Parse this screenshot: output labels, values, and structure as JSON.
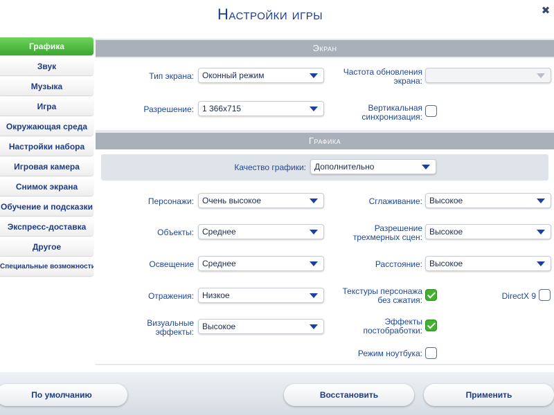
{
  "window": {
    "title": "Настройки игры",
    "close_glyph": "✖"
  },
  "sidebar": {
    "items": [
      {
        "label": "Графика"
      },
      {
        "label": "Звук"
      },
      {
        "label": "Музыка"
      },
      {
        "label": "Игра"
      },
      {
        "label": "Окружающая среда"
      },
      {
        "label": "Настройки набора"
      },
      {
        "label": "Игровая камера"
      },
      {
        "label": "Снимок экрана"
      },
      {
        "label": "Обучение и подсказки"
      },
      {
        "label": "Экспресс-доставка"
      },
      {
        "label": "Другое"
      },
      {
        "label": "Специальные возможности"
      }
    ],
    "active_index": 0
  },
  "screen": {
    "header": "Экран",
    "type": {
      "label": "Тип экрана:",
      "value": "Оконный режим"
    },
    "refresh": {
      "label": "Частота обновления экрана:",
      "value": ""
    },
    "resolution": {
      "label": "Разрешение:",
      "value": "1 366x715"
    },
    "vsync": {
      "label": "Вертикальная синхронизация:",
      "checked": false
    }
  },
  "graphics": {
    "header": "Графика",
    "quality": {
      "label": "Качество графики:",
      "value": "Дополнительно"
    },
    "characters": {
      "label": "Персонажи:",
      "value": "Очень высокое"
    },
    "antialiasing": {
      "label": "Сглаживание:",
      "value": "Высокое"
    },
    "objects": {
      "label": "Объекты:",
      "value": "Среднее"
    },
    "resolution3d": {
      "label": "Разрешение трехмерных сцен:",
      "value": "Высокое"
    },
    "lighting": {
      "label": "Освещение",
      "value": "Среднее"
    },
    "distance": {
      "label": "Расстояние:",
      "value": "Высокое"
    },
    "reflections": {
      "label": "Отражения:",
      "value": "Низкое"
    },
    "textures": {
      "label": "Текстуры персонажа без сжатия:",
      "checked": true
    },
    "directx9": {
      "label": "DirectX 9",
      "checked": false
    },
    "visual_effects": {
      "label": "Визуальные эффекты:",
      "value": "Высокое"
    },
    "postprocessing": {
      "label": "Эффекты постобработки:",
      "checked": true
    },
    "laptop_mode": {
      "label": "Режим ноутбука:",
      "checked": false
    }
  },
  "buttons": {
    "default": "По умолчанию",
    "restore": "Восстановить",
    "apply": "Применить"
  },
  "colors": {
    "accent_green": "#3aa72e",
    "title_blue": "#1a3c8e",
    "section_gray": "#a9b0ba"
  }
}
